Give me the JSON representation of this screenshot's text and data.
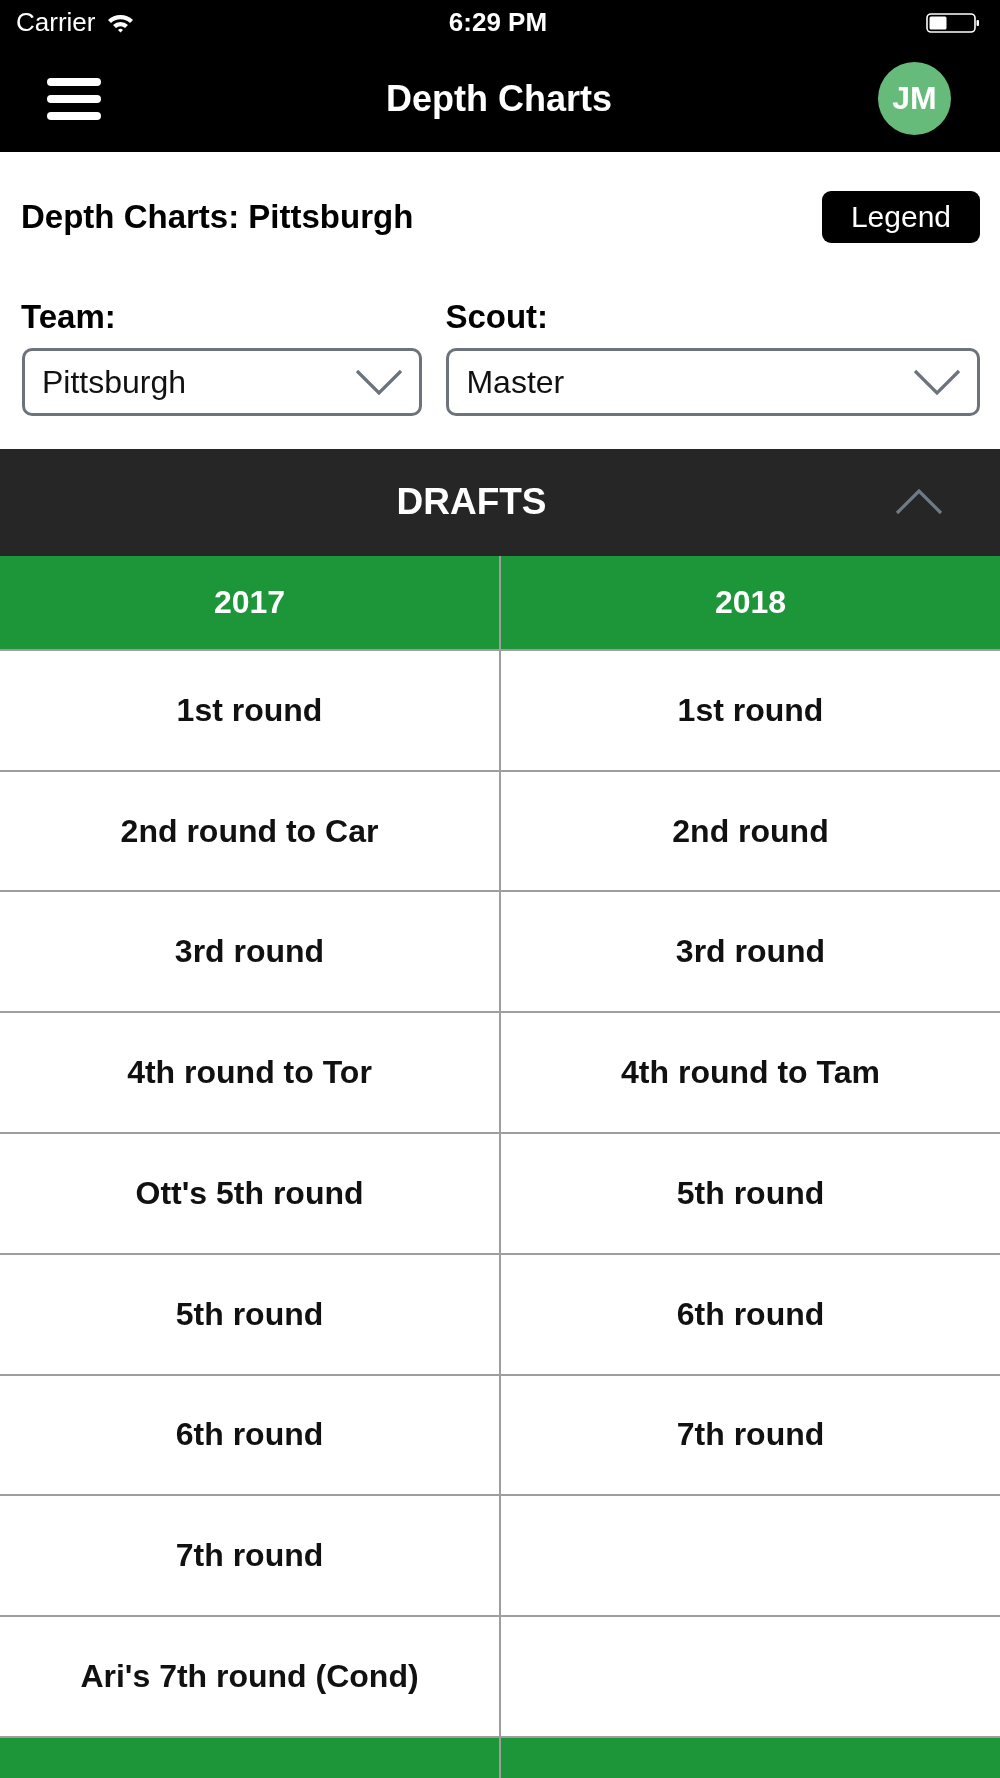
{
  "status_bar": {
    "carrier": "Carrier",
    "time": "6:29 PM"
  },
  "nav_bar": {
    "title": "Depth Charts",
    "avatar_initials": "JM"
  },
  "heading": {
    "title": "Depth Charts: Pittsburgh",
    "legend_button": "Legend"
  },
  "filters": [
    {
      "label": "Team:",
      "value": "Pittsburgh"
    },
    {
      "label": "Scout:",
      "value": "Master"
    }
  ],
  "section": {
    "title": "DRAFTS",
    "expanded": true,
    "columns": [
      {
        "year": "2017",
        "cells": [
          "1st round",
          "2nd round to Car",
          "3rd round",
          "4th round to Tor",
          "Ott's 5th round",
          "5th round",
          "6th round",
          "7th round",
          "Ari's 7th round (Cond)"
        ]
      },
      {
        "year": "2018",
        "cells": [
          "1st round",
          "2nd round",
          "3rd round",
          "4th round to Tam",
          "5th round",
          "6th round",
          "7th round"
        ]
      }
    ]
  }
}
